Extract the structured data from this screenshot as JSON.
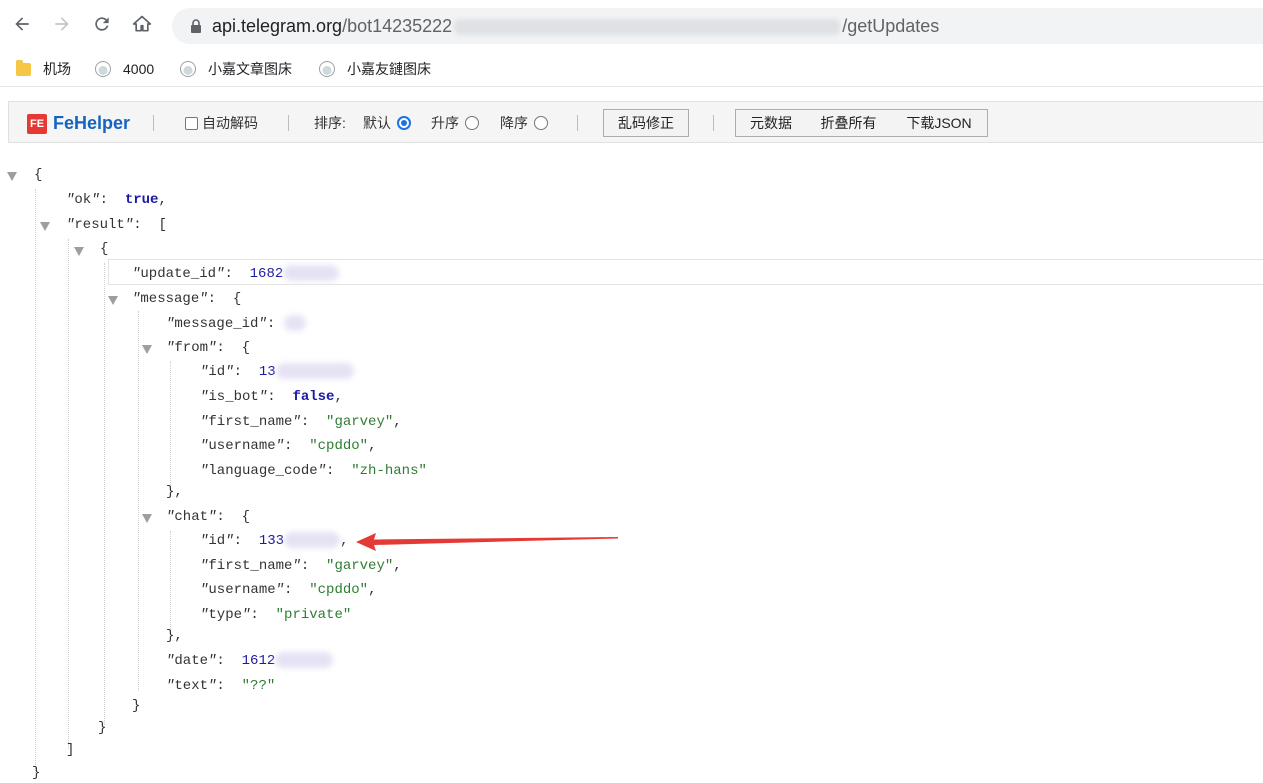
{
  "browser": {
    "url_host": "api.telegram.org",
    "url_path_start": "/bot14235222",
    "url_path_end": "/getUpdates",
    "bookmarks": [
      {
        "label": "机场",
        "icon": "folder-icon"
      },
      {
        "label": "4000",
        "icon": "globe-icon"
      },
      {
        "label": "小嘉文章图床",
        "icon": "globe-icon"
      },
      {
        "label": "小嘉友鏈图床",
        "icon": "globe-icon"
      }
    ]
  },
  "fehelper": {
    "logo_mark": "FE",
    "logo_text": "FeHelper",
    "auto_decode": "自动解码",
    "sort_label": "排序:",
    "sort_default": "默认",
    "sort_asc": "升序",
    "sort_desc": "降序",
    "sort_selected": "默认",
    "fix_btn": "乱码修正",
    "meta_btn": "元数据",
    "fold_btn": "折叠所有",
    "download_btn": "下载JSON"
  },
  "json": {
    "ok_key": "ok",
    "ok_val": "true",
    "result_key": "result",
    "update_id_key": "update_id",
    "update_id_val": "1682",
    "message_key": "message",
    "message_id_key": "message_id",
    "from_key": "from",
    "from_id_key": "id",
    "from_id_val": "13",
    "is_bot_key": "is_bot",
    "is_bot_val": "false",
    "first_name_key": "first_name",
    "first_name_val": "garvey",
    "username_key": "username",
    "username_val": "cpddo",
    "language_code_key": "language_code",
    "language_code_val": "zh-hans",
    "chat_key": "chat",
    "chat_id_key": "id",
    "chat_id_val": "133",
    "chat_first_name_key": "first_name",
    "chat_first_name_val": "garvey",
    "chat_username_key": "username",
    "chat_username_val": "cpddo",
    "type_key": "type",
    "type_val": "private",
    "date_key": "date",
    "date_val": "1612",
    "text_key": "text",
    "text_val": "??"
  },
  "colors": {
    "accent": "#1a73e8",
    "arrow": "#e53935",
    "number": "#1a1aa6",
    "string": "#2e7d32"
  }
}
